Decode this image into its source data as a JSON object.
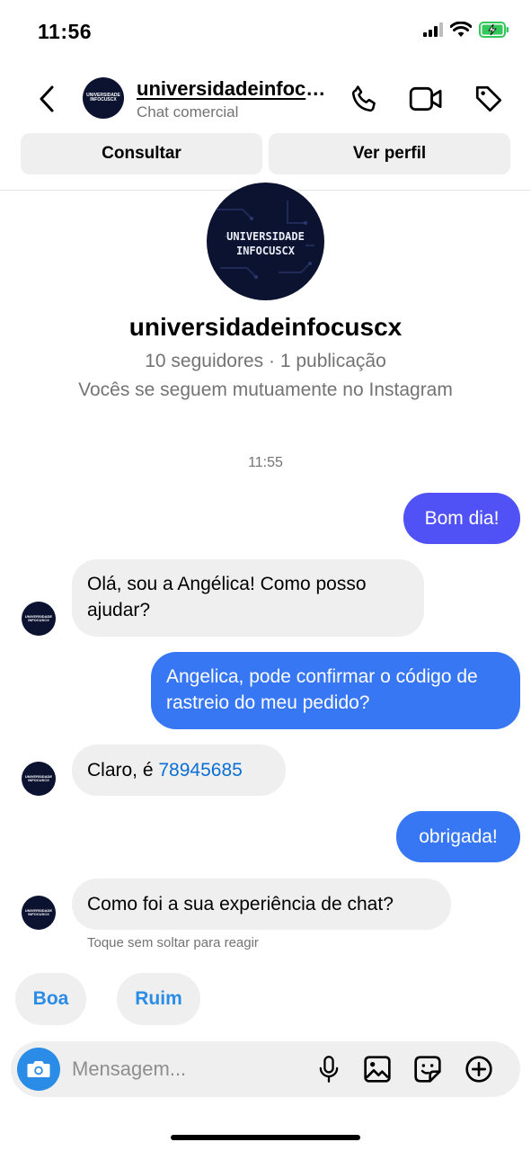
{
  "status_bar": {
    "time": "11:56",
    "icons": [
      "cellular-signal-icon",
      "wifi-icon",
      "battery-charging-icon"
    ],
    "battery_color": "#34c759"
  },
  "header": {
    "back_icon": "chevron-left-icon",
    "avatar_text": "UNIVERSIDADE INFOCUSCX",
    "title": "universidadeinfocuscx",
    "subtitle": "Chat comercial",
    "icons": [
      "phone-icon",
      "video-camera-icon",
      "tag-icon"
    ]
  },
  "actions": {
    "consult": "Consultar",
    "view_profile": "Ver perfil"
  },
  "profile": {
    "avatar_line1": "UNIVERSIDADE",
    "avatar_line2": "INFOCUSCX",
    "name": "universidadeinfocuscx",
    "stats": "10 seguidores · 1 publicação",
    "mutual": "Vocês se seguem mutuamente no Instagram"
  },
  "conversation": {
    "timestamp": "11:55",
    "messages": [
      {
        "from": "me",
        "text": "Bom dia!"
      },
      {
        "from": "them",
        "text": "Olá, sou a Angélica! Como posso ajudar?"
      },
      {
        "from": "me",
        "text": "Angelica, pode confirmar o código de rastreio do meu pedido?"
      },
      {
        "from": "them",
        "text_prefix": "Claro, é ",
        "link": "78945685"
      },
      {
        "from": "me",
        "text": "obrigada!"
      },
      {
        "from": "them",
        "text": "Como foi a sua experiência de chat?"
      }
    ],
    "hint": "Toque sem soltar para reagir"
  },
  "quick_replies": [
    "Boa",
    "Ruim"
  ],
  "composer": {
    "placeholder": "Mensagem...",
    "icons": [
      "camera-icon",
      "microphone-icon",
      "gallery-icon",
      "sticker-icon",
      "plus-circle-icon"
    ]
  },
  "colors": {
    "outgoing_bubble": "#5052f5",
    "outgoing_bubble_alt": "#3777f3",
    "incoming_bubble": "#efefef",
    "accent": "#2a8ce6",
    "link": "#0a6fd4"
  }
}
